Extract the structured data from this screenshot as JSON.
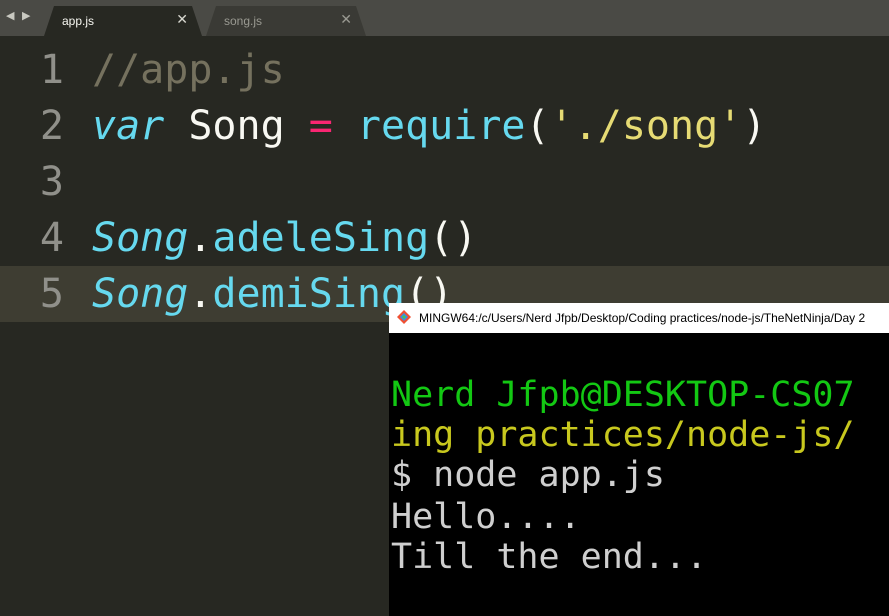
{
  "tabs": [
    {
      "label": "app.js",
      "close": "✕",
      "active": true
    },
    {
      "label": "song.js",
      "close": "✕",
      "active": false
    }
  ],
  "nav_arrows": "◀ ▶",
  "editor": {
    "lines": [
      {
        "num": "1",
        "tokens": [
          "//app.js"
        ]
      },
      {
        "num": "2",
        "tokens": [
          "var",
          " Song ",
          "=",
          " require",
          "(",
          "'./song'",
          ")"
        ]
      },
      {
        "num": "3",
        "tokens": []
      },
      {
        "num": "4",
        "tokens": [
          "Song",
          ".",
          "adeleSing",
          "()"
        ]
      },
      {
        "num": "5",
        "tokens": [
          "Song",
          ".",
          "demiSing",
          "()"
        ]
      }
    ],
    "current_line": "5"
  },
  "terminal": {
    "title": "MINGW64:/c/Users/Nerd Jfpb/Desktop/Coding practices/node-js/TheNetNinja/Day 2",
    "lines": [
      "Nerd Jfpb@DESKTOP-CS07",
      "ing practices/node-js/",
      "$ node app.js",
      "Hello....",
      "Till the end..."
    ]
  },
  "colors": {
    "editor_bg": "#272822",
    "keyword": "#66d9ef",
    "operator": "#f92672",
    "string": "#e6db74",
    "comment": "#75715e",
    "terminal_prompt_green": "#13c813",
    "terminal_path_yellow": "#c8c81e"
  }
}
